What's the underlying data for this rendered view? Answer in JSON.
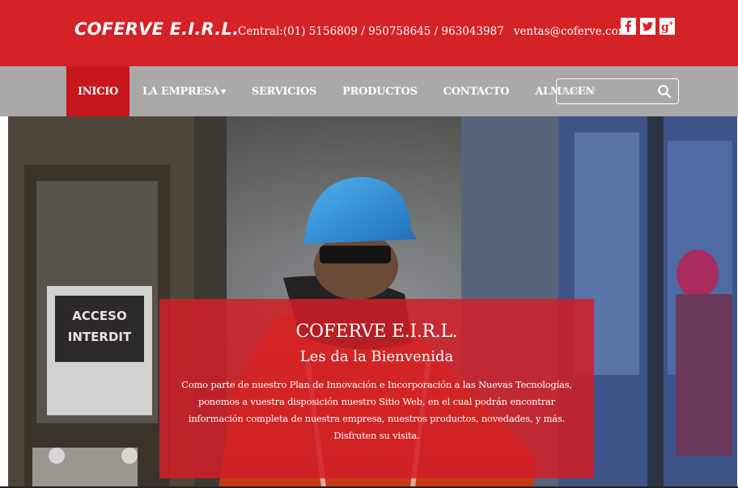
{
  "header": {
    "brand": "COFERVE E.I.R.L.",
    "phones": "Central:(01) 5156809 / 950758645 / 963043987",
    "email": "ventas@coferve.com",
    "social": [
      {
        "icon": "facebook-icon",
        "glyph": "f"
      },
      {
        "icon": "twitter-icon",
        "glyph": "t"
      },
      {
        "icon": "google-plus-icon",
        "glyph": "g+"
      }
    ]
  },
  "nav": {
    "items": [
      {
        "label": "INICIO",
        "active": true
      },
      {
        "label": "LA EMPRESA",
        "dropdown": true
      },
      {
        "label": "SERVICIOS"
      },
      {
        "label": "PRODUCTOS"
      },
      {
        "label": "CONTACTO"
      },
      {
        "label": "ALMACEN"
      }
    ],
    "search": {
      "placeholder": "Buscar",
      "value": "",
      "icon": "search-icon"
    }
  },
  "hero": {
    "title": "COFERVE E.I.R.L.",
    "subtitle": "Les da la Bienvenida",
    "body": "Como parte de nuestro Plan de Innovación e Incorporación a las Nuevas Tecnologías, ponemos a vuestra disposición nuestro Sitio Web, en el cual podrán encontrar información completa de nuestra empresa, nuestros productos, novedades, y más.",
    "closing": "Disfruten su visita.",
    "sign_text": "ACCESO INTERDIT"
  },
  "colors": {
    "brand_red": "#d42226",
    "nav_gray": "#a9a9a9",
    "active_red": "#c8161d",
    "helmet_blue": "#2f8fdc"
  }
}
